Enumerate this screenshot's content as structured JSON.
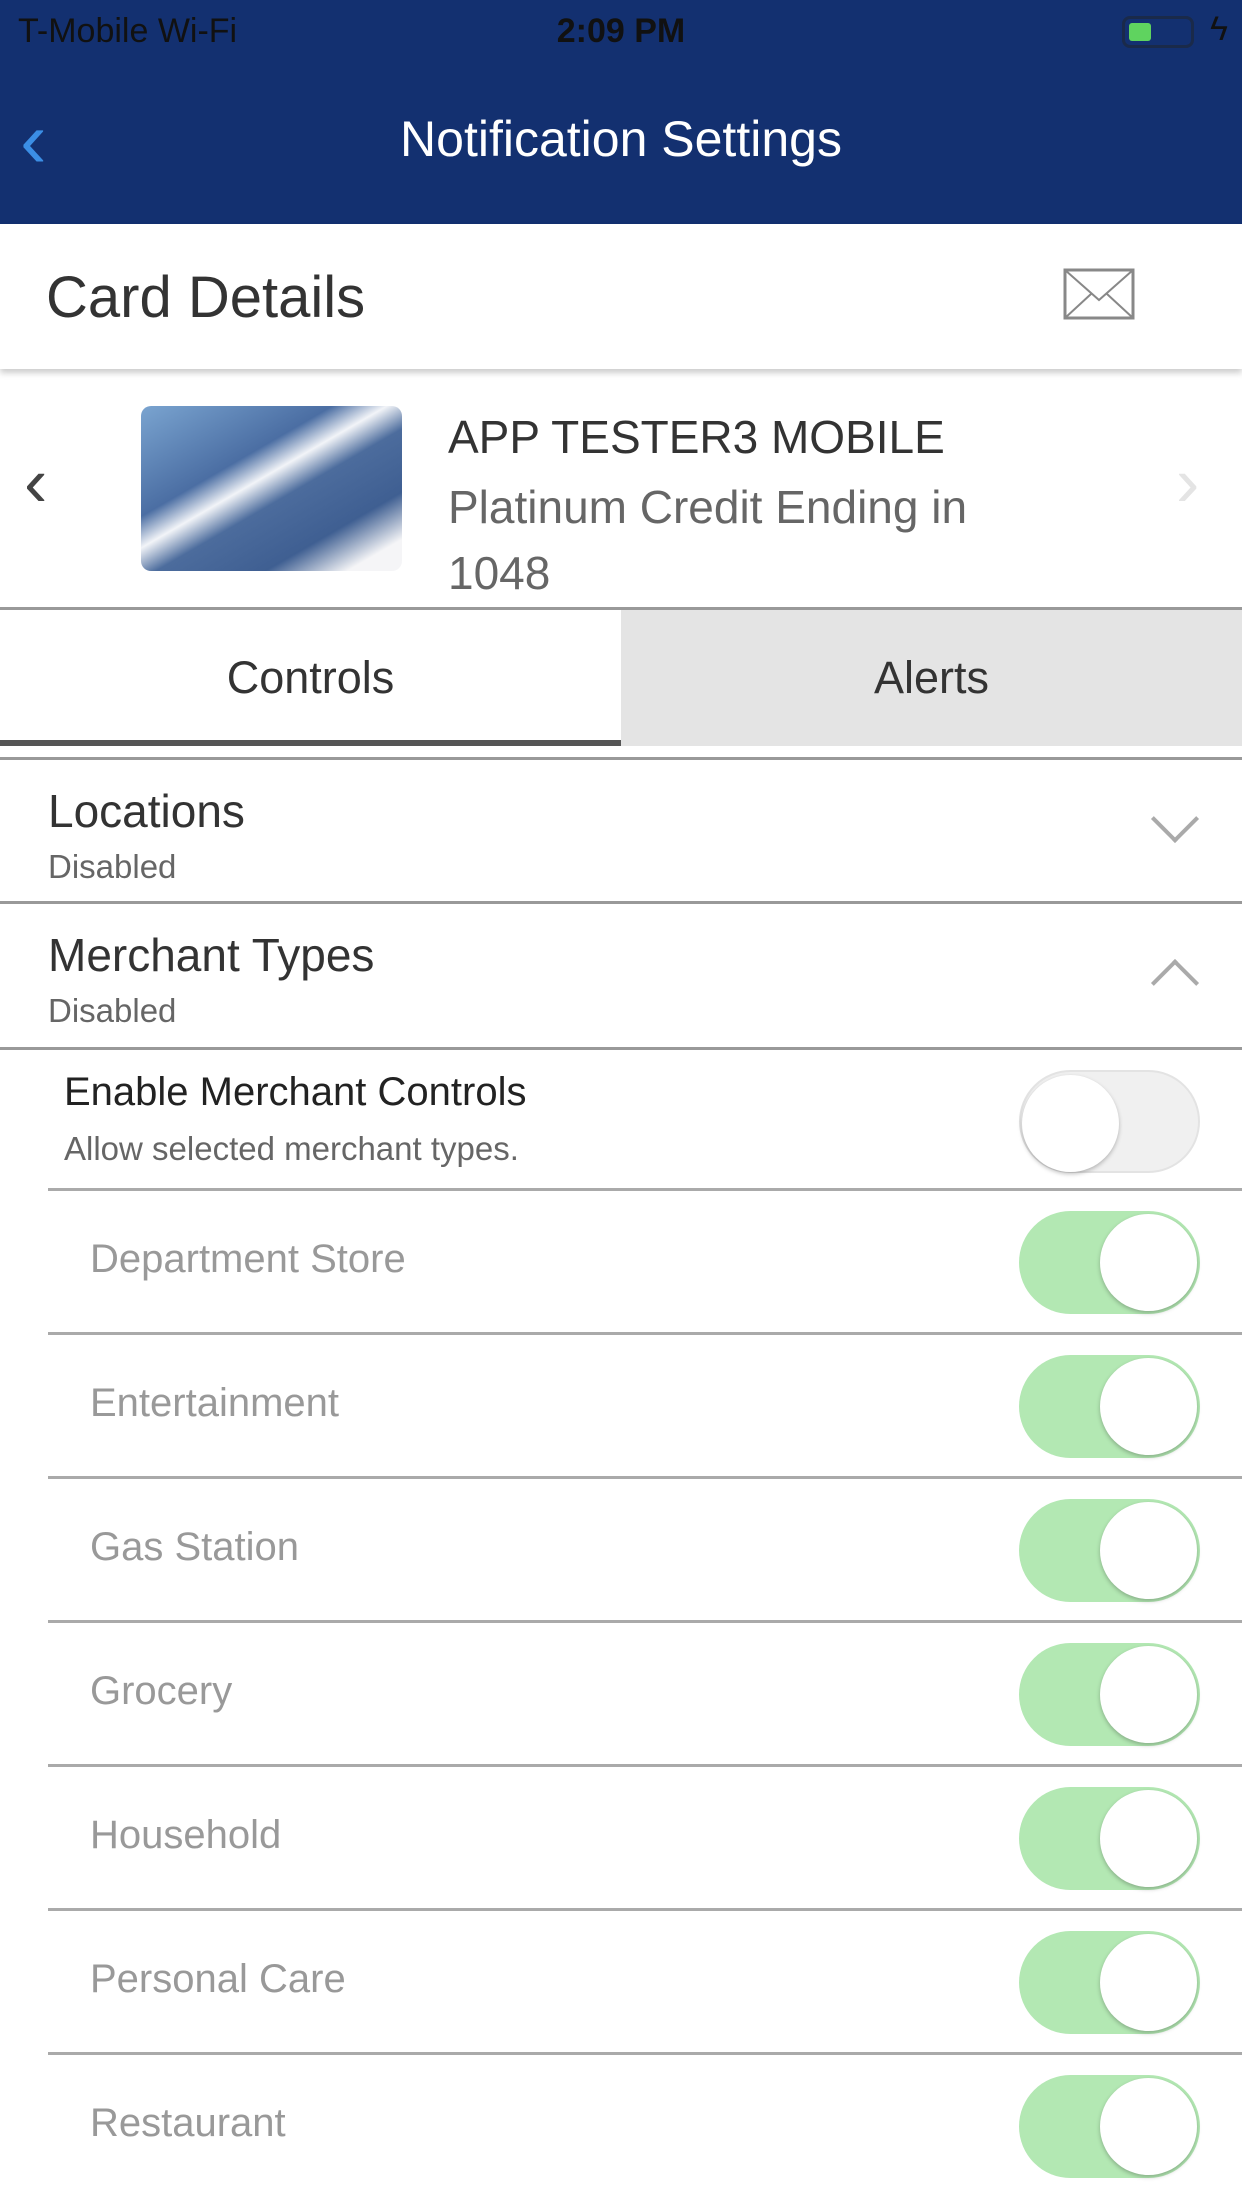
{
  "status_bar": {
    "carrier": "T-Mobile Wi-Fi",
    "time": "2:09 PM",
    "battery_color": "#5fd35f"
  },
  "nav": {
    "title": "Notification Settings",
    "background": "#133070",
    "back_color": "#3b8ee5"
  },
  "header": {
    "title": "Card Details",
    "icon": "mail-icon"
  },
  "card": {
    "name": "APP TESTER3 MOBILE",
    "description": "Platinum Credit Ending in 1048"
  },
  "tabs": [
    {
      "label": "Controls",
      "active": true
    },
    {
      "label": "Alerts",
      "active": false
    }
  ],
  "sections": [
    {
      "title": "Locations",
      "status": "Disabled",
      "expanded": false
    },
    {
      "title": "Merchant Types",
      "status": "Disabled",
      "expanded": true
    }
  ],
  "enable": {
    "title": "Enable Merchant Controls",
    "subtitle": "Allow selected merchant types.",
    "on": false
  },
  "merchants": [
    {
      "label": "Department Store",
      "on": true
    },
    {
      "label": "Entertainment",
      "on": true
    },
    {
      "label": "Gas Station",
      "on": true
    },
    {
      "label": "Grocery",
      "on": true
    },
    {
      "label": "Household",
      "on": true
    },
    {
      "label": "Personal Care",
      "on": true
    },
    {
      "label": "Restaurant",
      "on": true
    }
  ],
  "toggle_on_color": "#b3e8b3"
}
